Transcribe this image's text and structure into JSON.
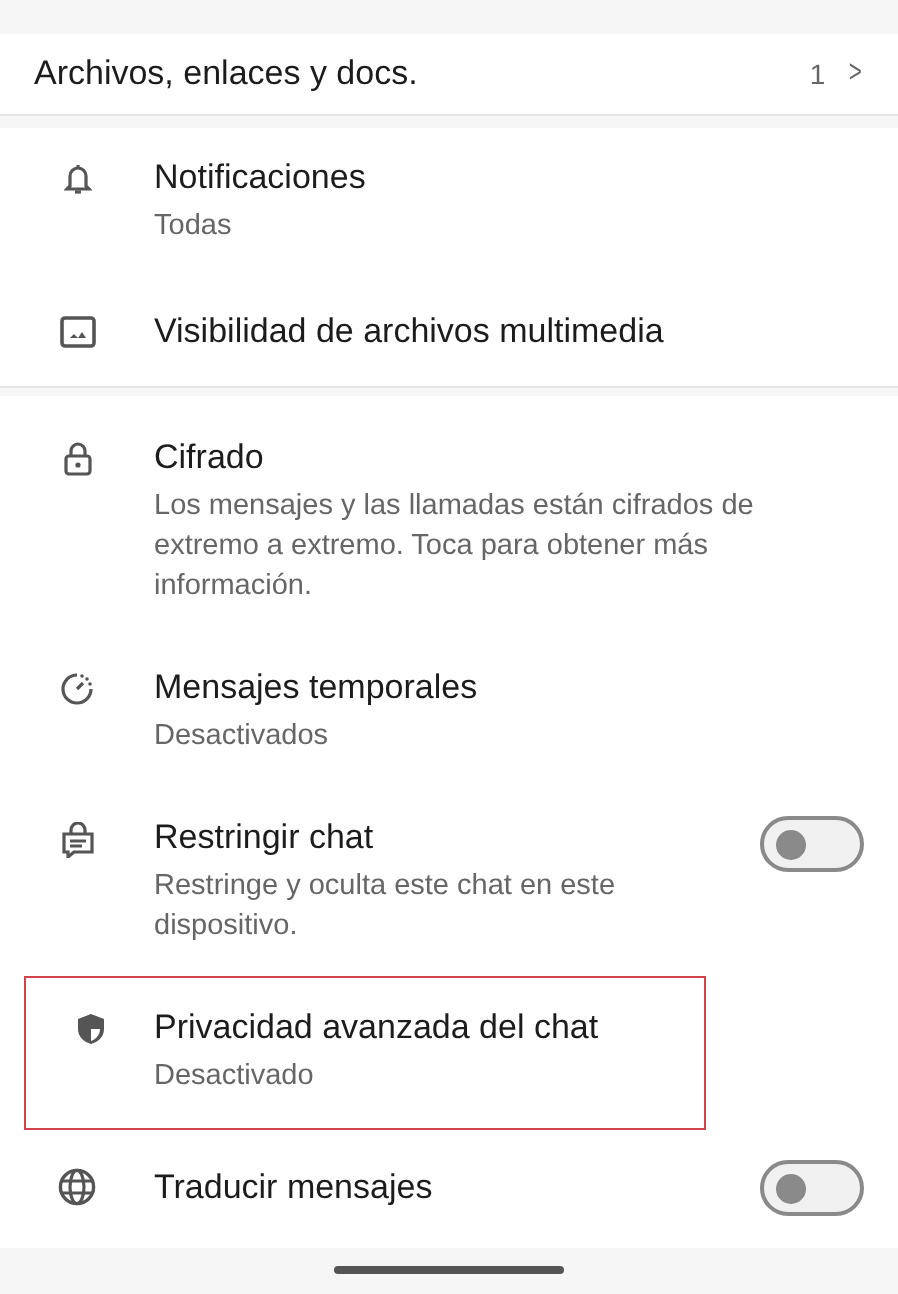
{
  "files_row": {
    "label": "Archivos, enlaces y docs.",
    "count": "1",
    "chevron": ">"
  },
  "settings": [
    {
      "title": "Notificaciones",
      "subtitle": "Todas"
    },
    {
      "title": "Visibilidad de archivos multimedia"
    }
  ],
  "privacy": [
    {
      "title": "Cifrado",
      "subtitle": "Los mensajes y las llamadas están cifrados de extremo a extremo. Toca para obtener más información.",
      "kind": "plain"
    },
    {
      "title": "Mensajes temporales",
      "subtitle": "Desactivados",
      "kind": "plain"
    },
    {
      "title": "Restringir chat",
      "subtitle": "Restringe y oculta este chat en este dispositivo.",
      "kind": "toggle",
      "on": false
    },
    {
      "title": "Privacidad avanzada del chat",
      "subtitle": "Desactivado",
      "kind": "plain",
      "highlighted": true
    },
    {
      "title": "Traducir mensajes",
      "kind": "toggle",
      "on": false
    }
  ]
}
